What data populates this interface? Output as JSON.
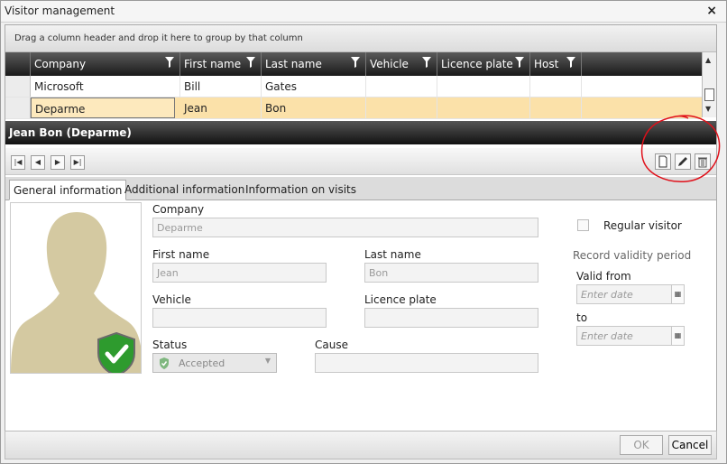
{
  "window": {
    "title": "Visitor management",
    "close": "×"
  },
  "grid": {
    "group_hint": "Drag a column header and drop it here to group by that column",
    "columns": [
      "Company",
      "First name",
      "Last name",
      "Vehicle",
      "Licence plate",
      "Host"
    ],
    "rows": [
      [
        "Microsoft",
        "Bill",
        "Gates",
        "",
        "",
        ""
      ],
      [
        "Deparme",
        "Jean",
        "Bon",
        "",
        "",
        ""
      ]
    ],
    "selected_row": 1
  },
  "detail": {
    "title": "Jean Bon (Deparme)",
    "nav": [
      "|◀",
      "◀",
      "▶",
      "▶|"
    ]
  },
  "tabs": [
    "General information",
    "Additional information",
    "Information on visits"
  ],
  "form": {
    "company_label": "Company",
    "company_value": "Deparme",
    "first_name_label": "First name",
    "first_name_value": "Jean",
    "last_name_label": "Last name",
    "last_name_value": "Bon",
    "vehicle_label": "Vehicle",
    "vehicle_value": "",
    "licence_label": "Licence plate",
    "licence_value": "",
    "status_label": "Status",
    "status_value": "Accepted",
    "cause_label": "Cause",
    "cause_value": "",
    "regular_visitor_label": "Regular visitor",
    "validity_label": "Record validity period",
    "valid_from_label": "Valid from",
    "valid_from_placeholder": "Enter date",
    "to_label": "to",
    "to_placeholder": "Enter date"
  },
  "footer": {
    "ok_label": "OK",
    "cancel_label": "Cancel"
  },
  "colors": {
    "selected_row": "#fbe1a9",
    "header_dark": "#1a1a1a",
    "annotation": "#e0101a",
    "status_ok": "#2e9b2e",
    "silhouette": "#d4c9a1"
  }
}
